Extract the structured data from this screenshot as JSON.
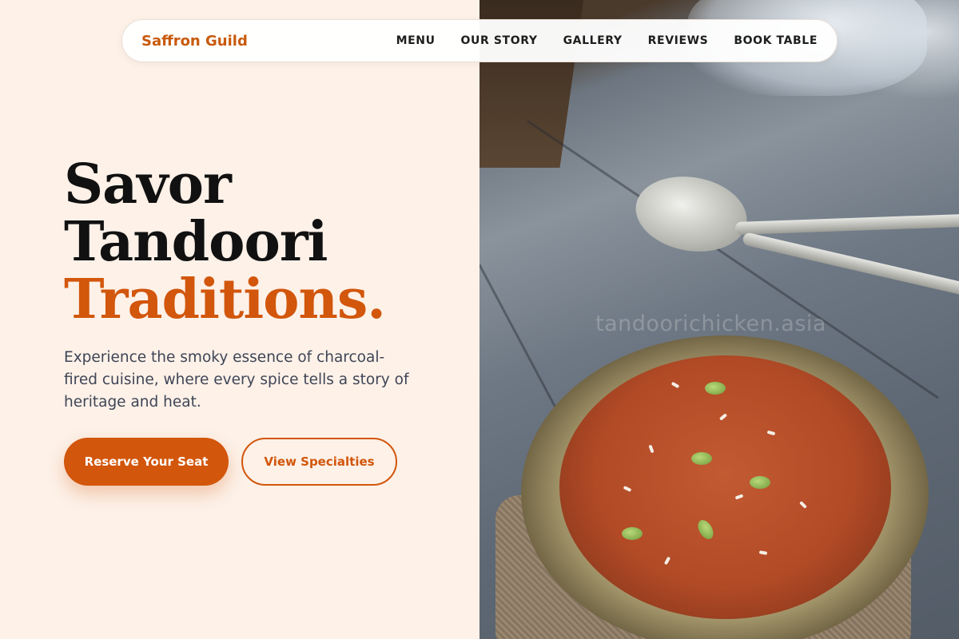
{
  "brand": {
    "name": "Saffron Guild",
    "color": "#c85a0c"
  },
  "nav": {
    "items": [
      {
        "label": "MENU"
      },
      {
        "label": "OUR STORY"
      },
      {
        "label": "GALLERY"
      },
      {
        "label": "REVIEWS"
      },
      {
        "label": "BOOK TABLE"
      }
    ]
  },
  "hero": {
    "headline_line1": "Savor",
    "headline_line2": "Tandoori",
    "headline_accent": "Traditions.",
    "lead": "Experience the smoky essence of charcoal-fired cuisine, where every spice tells a story of heritage and heat.",
    "primary_cta": "Reserve Your Seat",
    "secondary_cta": "View Specialties",
    "accent_color": "#d2560b"
  },
  "image": {
    "watermark": "tandoorichicken.asia"
  }
}
